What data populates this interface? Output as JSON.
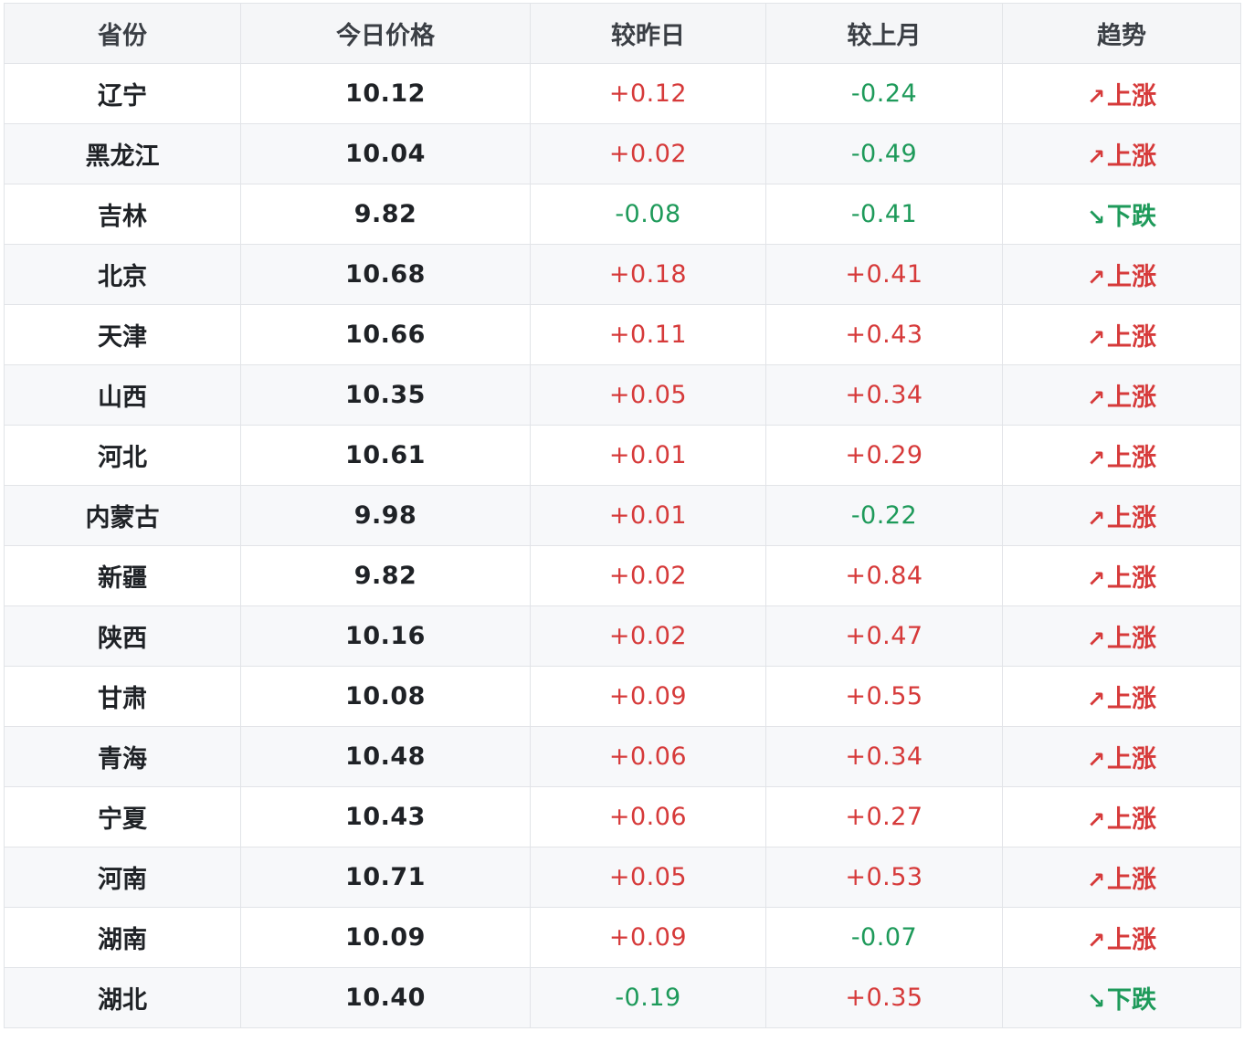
{
  "headers": [
    "省份",
    "今日价格",
    "较昨日",
    "较上月",
    "趋势"
  ],
  "colors": {
    "up": "#d63a3a",
    "down": "#1e9a5a"
  },
  "rows": [
    {
      "province": "辽宁",
      "price": "10.12",
      "day": "+0.12",
      "day_dir": "up",
      "month": "-0.24",
      "month_dir": "down",
      "trend_icon": "↗",
      "trend": "上涨",
      "trend_dir": "up"
    },
    {
      "province": "黑龙江",
      "price": "10.04",
      "day": "+0.02",
      "day_dir": "up",
      "month": "-0.49",
      "month_dir": "down",
      "trend_icon": "↗",
      "trend": "上涨",
      "trend_dir": "up"
    },
    {
      "province": "吉林",
      "price": "9.82",
      "day": "-0.08",
      "day_dir": "down",
      "month": "-0.41",
      "month_dir": "down",
      "trend_icon": "↘",
      "trend": "下跌",
      "trend_dir": "down"
    },
    {
      "province": "北京",
      "price": "10.68",
      "day": "+0.18",
      "day_dir": "up",
      "month": "+0.41",
      "month_dir": "up",
      "trend_icon": "↗",
      "trend": "上涨",
      "trend_dir": "up"
    },
    {
      "province": "天津",
      "price": "10.66",
      "day": "+0.11",
      "day_dir": "up",
      "month": "+0.43",
      "month_dir": "up",
      "trend_icon": "↗",
      "trend": "上涨",
      "trend_dir": "up"
    },
    {
      "province": "山西",
      "price": "10.35",
      "day": "+0.05",
      "day_dir": "up",
      "month": "+0.34",
      "month_dir": "up",
      "trend_icon": "↗",
      "trend": "上涨",
      "trend_dir": "up"
    },
    {
      "province": "河北",
      "price": "10.61",
      "day": "+0.01",
      "day_dir": "up",
      "month": "+0.29",
      "month_dir": "up",
      "trend_icon": "↗",
      "trend": "上涨",
      "trend_dir": "up"
    },
    {
      "province": "内蒙古",
      "price": "9.98",
      "day": "+0.01",
      "day_dir": "up",
      "month": "-0.22",
      "month_dir": "down",
      "trend_icon": "↗",
      "trend": "上涨",
      "trend_dir": "up"
    },
    {
      "province": "新疆",
      "price": "9.82",
      "day": "+0.02",
      "day_dir": "up",
      "month": "+0.84",
      "month_dir": "up",
      "trend_icon": "↗",
      "trend": "上涨",
      "trend_dir": "up"
    },
    {
      "province": "陕西",
      "price": "10.16",
      "day": "+0.02",
      "day_dir": "up",
      "month": "+0.47",
      "month_dir": "up",
      "trend_icon": "↗",
      "trend": "上涨",
      "trend_dir": "up"
    },
    {
      "province": "甘肃",
      "price": "10.08",
      "day": "+0.09",
      "day_dir": "up",
      "month": "+0.55",
      "month_dir": "up",
      "trend_icon": "↗",
      "trend": "上涨",
      "trend_dir": "up"
    },
    {
      "province": "青海",
      "price": "10.48",
      "day": "+0.06",
      "day_dir": "up",
      "month": "+0.34",
      "month_dir": "up",
      "trend_icon": "↗",
      "trend": "上涨",
      "trend_dir": "up"
    },
    {
      "province": "宁夏",
      "price": "10.43",
      "day": "+0.06",
      "day_dir": "up",
      "month": "+0.27",
      "month_dir": "up",
      "trend_icon": "↗",
      "trend": "上涨",
      "trend_dir": "up"
    },
    {
      "province": "河南",
      "price": "10.71",
      "day": "+0.05",
      "day_dir": "up",
      "month": "+0.53",
      "month_dir": "up",
      "trend_icon": "↗",
      "trend": "上涨",
      "trend_dir": "up"
    },
    {
      "province": "湖南",
      "price": "10.09",
      "day": "+0.09",
      "day_dir": "up",
      "month": "-0.07",
      "month_dir": "down",
      "trend_icon": "↗",
      "trend": "上涨",
      "trend_dir": "up"
    },
    {
      "province": "湖北",
      "price": "10.40",
      "day": "-0.19",
      "day_dir": "down",
      "month": "+0.35",
      "month_dir": "up",
      "trend_icon": "↘",
      "trend": "下跌",
      "trend_dir": "down"
    }
  ]
}
